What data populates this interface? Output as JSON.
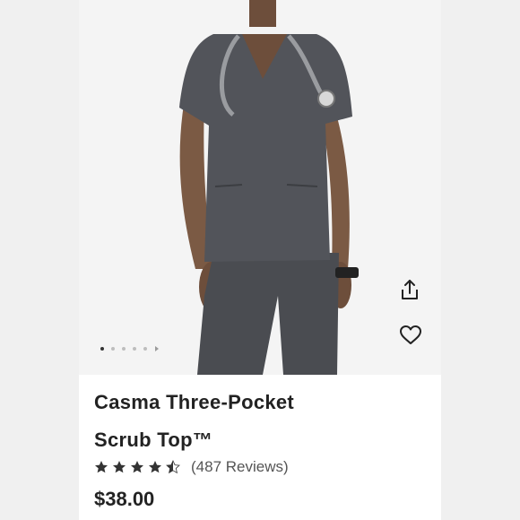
{
  "product": {
    "title_line1": "Casma Three-Pocket",
    "title_line2": "Scrub Top™",
    "rating": 4.5,
    "rating_max": 5,
    "reviews_text": "(487 Reviews)",
    "price": "$38.00"
  },
  "gallery": {
    "image_count": 5,
    "active_index": 0
  },
  "icons": {
    "share": "share-icon",
    "favorite": "heart-icon",
    "star": "star-icon"
  },
  "colors": {
    "scrub": "#4a4c51",
    "skin": "#7b5a44",
    "text": "#222222"
  }
}
